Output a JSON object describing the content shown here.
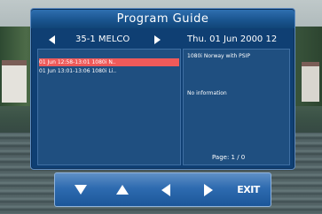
{
  "guide": {
    "title": "Program Guide",
    "channel": "35-1 MELCO",
    "date": "Thu.   01 Jun 2000 12"
  },
  "programs": [
    {
      "text": "01 Jun 12:58-13:01  1080i N..",
      "selected": true
    },
    {
      "text": "01 Jun 13:01-13:06  1080i Li..",
      "selected": false
    }
  ],
  "info": {
    "title": "1080i Norway with PSIP",
    "text": "No information",
    "page": "Page:  1 /  0"
  },
  "buttons": {
    "exit_label": "EXIT"
  },
  "colors": {
    "panel": "#0f3f73",
    "selected_row": "#ee5a5a"
  }
}
